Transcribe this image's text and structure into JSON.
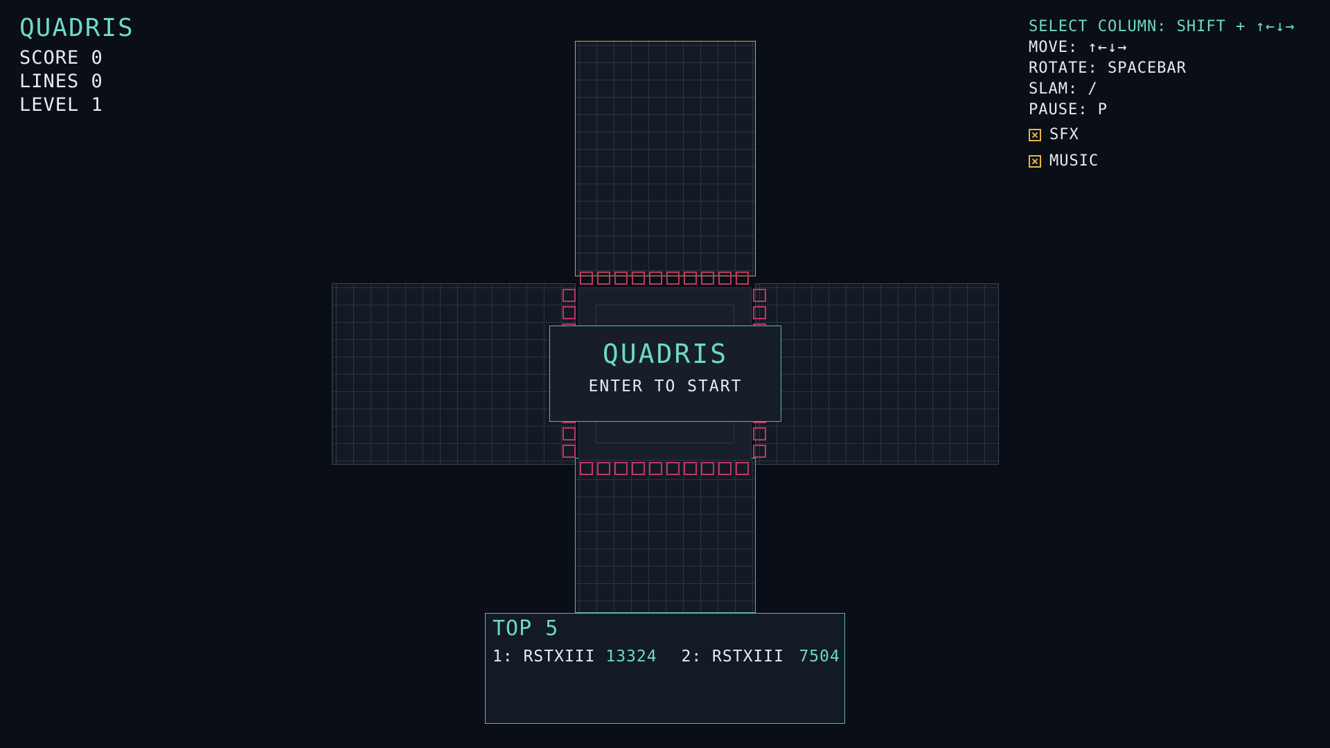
{
  "hud": {
    "title": "QUADRIS",
    "score": "SCORE 0",
    "lines": "LINES 0",
    "level": "LEVEL 1"
  },
  "controls": {
    "select_column": "SELECT COLUMN: SHIFT + ↑←↓→",
    "move": "MOVE: ↑←↓→",
    "rotate": "ROTATE: SPACEBAR",
    "slam": "SLAM: /",
    "pause": "PAUSE: P",
    "sfx": {
      "label": "SFX",
      "checked": true
    },
    "music": {
      "label": "MUSIC",
      "checked": true
    }
  },
  "start_panel": {
    "title": "QUADRIS",
    "hint": "ENTER TO START"
  },
  "scoreboard": {
    "title": "TOP 5",
    "entries": [
      {
        "rank": "1:",
        "name": "RSTXIII",
        "score": "13324"
      },
      {
        "rank": "2:",
        "name": "RSTXIII",
        "score": "7504"
      }
    ]
  },
  "colors": {
    "background": "#0a0e16",
    "accent": "#6fd9c4",
    "active_well_border": "#c9a45c",
    "spawn_marker": "#c2375e",
    "checkbox": "#e8b54a"
  }
}
